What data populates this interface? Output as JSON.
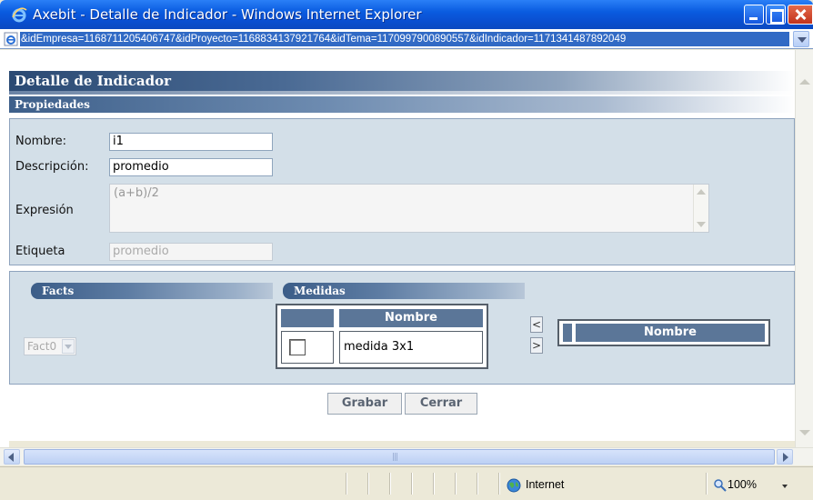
{
  "window": {
    "title": "Axebit - Detalle de Indicador - Windows Internet Explorer",
    "address": "&idEmpresa=1168711205406747&idProyecto=1168834137921764&idTema=1170997900890557&idIndicador=1171341487892049"
  },
  "page": {
    "header": "Detalle de Indicador",
    "properties_section": "Propiedades"
  },
  "form": {
    "nombre_label": "Nombre:",
    "nombre_value": "i1",
    "descripcion_label": "Descripción:",
    "descripcion_value": "promedio",
    "expresion_label": "Expresión",
    "expresion_value": "(a+b)/2",
    "etiqueta_label": "Etiqueta",
    "etiqueta_value": "promedio"
  },
  "facts": {
    "header": "Facts",
    "selected": "Fact0"
  },
  "medidas": {
    "header": "Medidas",
    "column_header": "Nombre",
    "rows": [
      {
        "name": "medida 3x1",
        "checked": false
      }
    ],
    "move_left_label": "<",
    "move_right_label": ">"
  },
  "selected_medidas": {
    "column_header": "Nombre"
  },
  "actions": {
    "grabar": "Grabar",
    "cerrar": "Cerrar"
  },
  "status": {
    "zone": "Internet",
    "zoom": "100%"
  },
  "colors": {
    "titlebar": "#0a50d2",
    "panel_bg": "#d3dfe8",
    "table_header": "#5b7698",
    "section_header": "#3d5f8a"
  }
}
